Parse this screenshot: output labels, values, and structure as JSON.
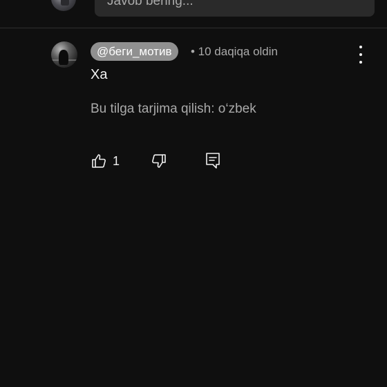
{
  "composer": {
    "placeholder": "Javob bering..."
  },
  "comment": {
    "author": "@беги_мотив",
    "time": "• 10 daqiqa oldin",
    "text": "Xa",
    "translate": "Bu tilga tarjima qilish: o‘zbek",
    "like_count": "1"
  },
  "icons": {
    "more": "more-vertical-icon",
    "like": "thumbs-up-icon",
    "dislike": "thumbs-down-icon",
    "reply": "reply-comment-icon"
  },
  "colors": {
    "background": "#0f0f0f",
    "author_chip": "#909090",
    "secondary_text": "#aaaaaa",
    "primary_text": "#f1f1f1"
  }
}
